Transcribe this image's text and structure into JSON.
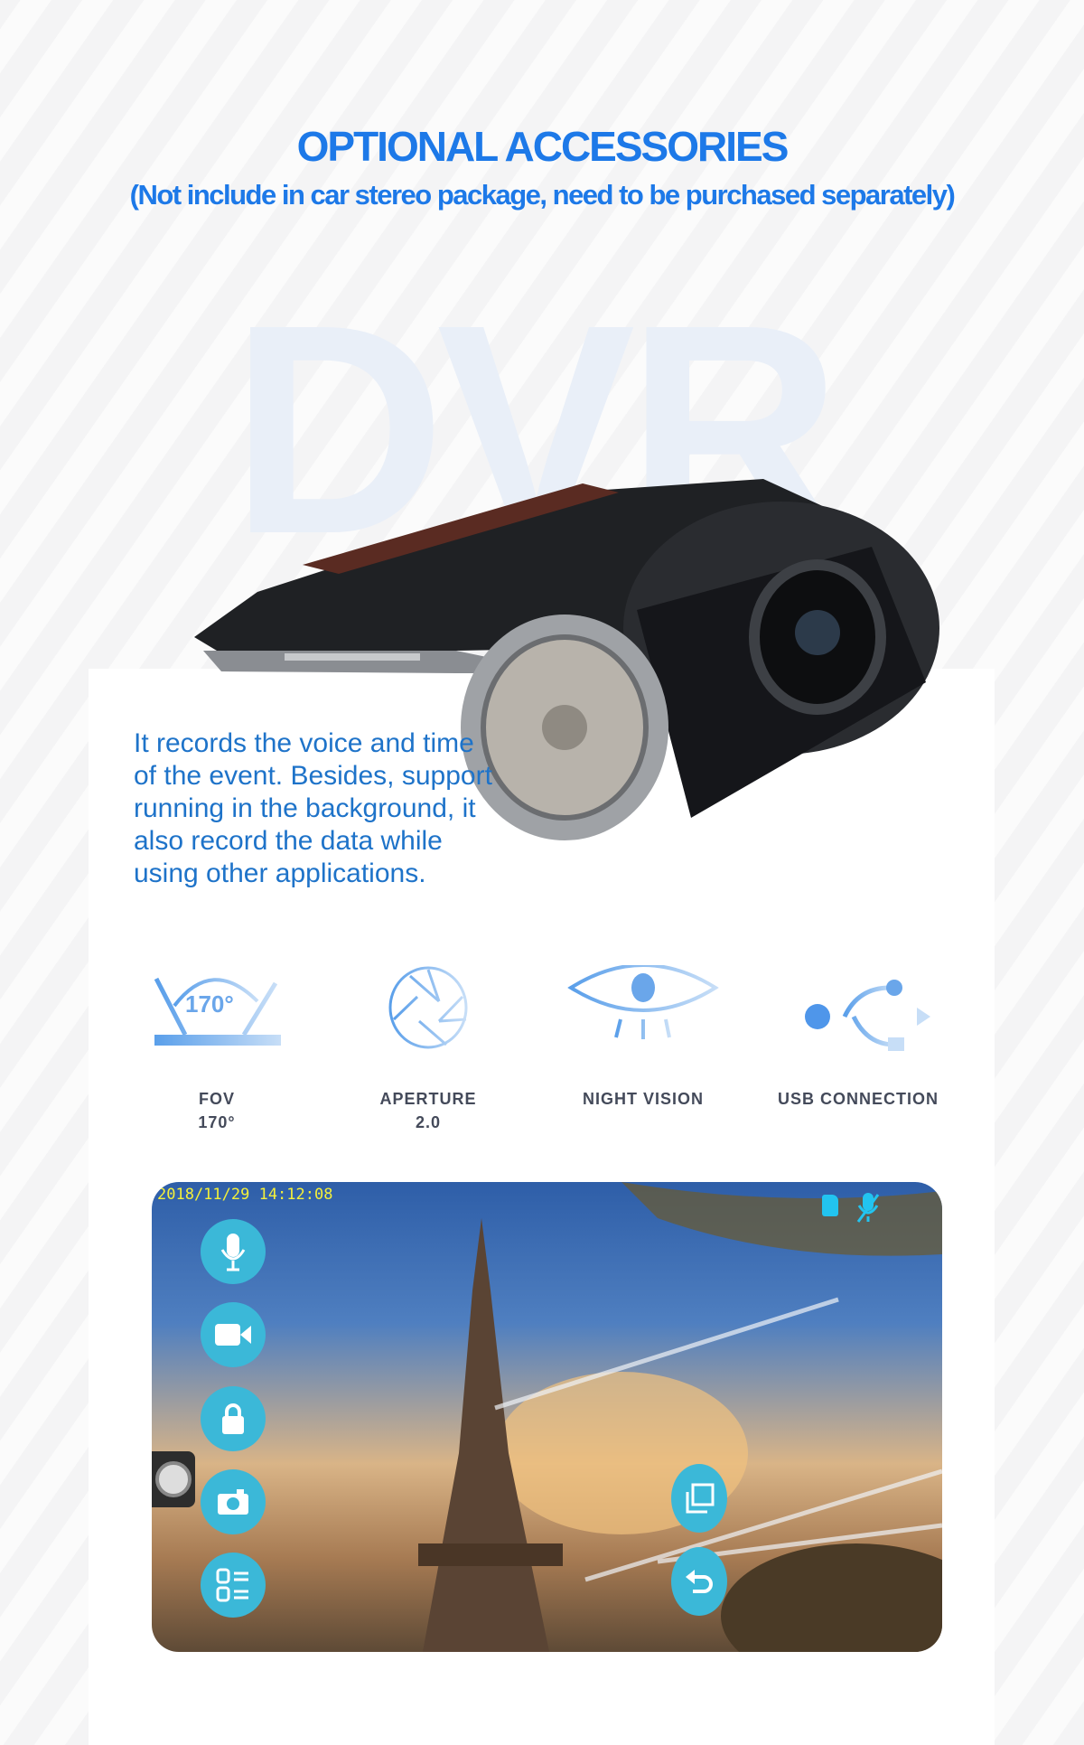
{
  "header": {
    "title": "OPTIONAL ACCESSORIES",
    "subtitle": "(Not include in car stereo package, need to be purchased separately)"
  },
  "product": {
    "watermark": "DVR",
    "description": "It records the voice and time of the event. Besides, support running in the background, it also record the data while using other applications."
  },
  "features": [
    {
      "icon": "fov-170-icon",
      "label": "FOV",
      "value": "170°",
      "icon_text": "170°"
    },
    {
      "icon": "aperture-icon",
      "label": "APERTURE",
      "value": "2.0"
    },
    {
      "icon": "night-vision-eye-icon",
      "label": "NIGHT VISION"
    },
    {
      "icon": "usb-icon",
      "label": "USB CONNECTION"
    }
  ],
  "app_screen": {
    "timestamp": "2018/11/29 14:12:08",
    "status_icons": [
      "sd-card-icon",
      "mic-muted-icon"
    ],
    "left_buttons": [
      "microphone-icon",
      "video-camera-icon",
      "lock-icon",
      "camera-icon",
      "menu-list-icon"
    ],
    "right_buttons": [
      "copy-window-icon",
      "back-icon"
    ],
    "accent": "#3bb8d8"
  },
  "colors": {
    "brand": "#1d79e8",
    "text": "#1e73c9",
    "label": "#444a5a"
  }
}
